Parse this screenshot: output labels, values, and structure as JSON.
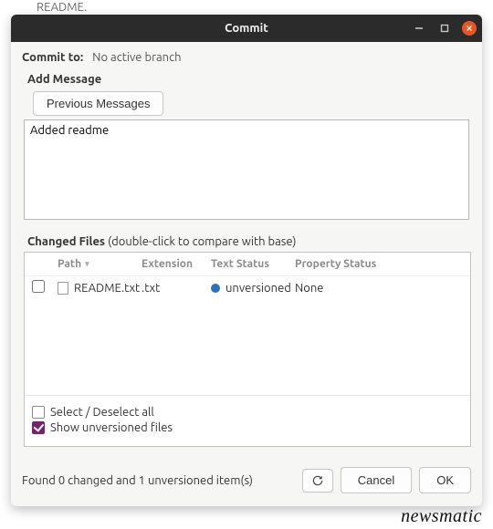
{
  "background_hint": "README.",
  "window": {
    "title": "Commit"
  },
  "commit_to": {
    "label": "Commit to:",
    "value": "No active branch"
  },
  "message": {
    "section_label": "Add Message",
    "previous_button": "Previous Messages",
    "text": "Added readme"
  },
  "changed_files": {
    "label_strong": "Changed Files",
    "label_hint": " (double-click to compare with base)",
    "columns": {
      "path": "Path",
      "extension": "Extension",
      "text_status": "Text Status",
      "property_status": "Property Status"
    },
    "rows": [
      {
        "checked": false,
        "path": "README.txt",
        "extension": ".txt",
        "text_status": "unversioned",
        "property_status": "None"
      }
    ]
  },
  "options": {
    "select_all": {
      "label": "Select / Deselect all",
      "checked": false
    },
    "show_unversioned": {
      "label": "Show unversioned files",
      "checked": true
    }
  },
  "footer": {
    "status": "Found 0 changed and 1 unversioned item(s)",
    "cancel": "Cancel",
    "ok": "OK"
  },
  "watermark": "newsmatic"
}
